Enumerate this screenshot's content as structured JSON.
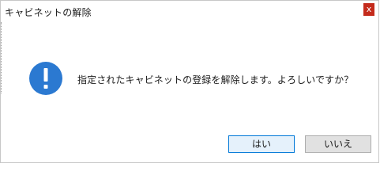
{
  "window": {
    "title": "キャビネットの解除",
    "close_glyph": "x"
  },
  "dialog": {
    "icon": "information-icon",
    "icon_color": "#2b79d1",
    "message": "指定されたキャビネットの登録を解除します。よろしいですか？"
  },
  "buttons": {
    "yes_label": "はい",
    "no_label": "いいえ",
    "default_border_color": "#0078d7"
  }
}
